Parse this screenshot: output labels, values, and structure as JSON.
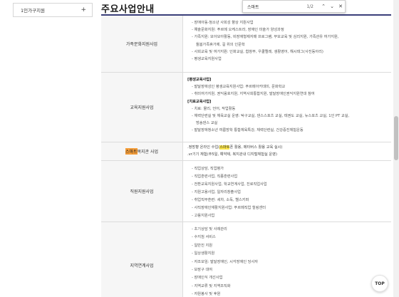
{
  "sidebar": {
    "item_label": "1인가구지원",
    "expand_glyph": "+"
  },
  "page": {
    "title": "주요사업안내"
  },
  "findbar": {
    "query": "스마트",
    "count": "1/2",
    "prev": "⌃",
    "next": "⌄",
    "close": "✕"
  },
  "rows": [
    {
      "name": "가족문화지원사업",
      "lines": [
        {
          "t": "장애아동·청소년 사회성 향상 지원사업",
          "k": "dash"
        },
        {
          "t": "예술문화지원: 푸르메 오케스트라, 장애인 미술가 양성과정",
          "k": "dash"
        },
        {
          "t": "가족지원: 모아모아활동, 비장애형제자매 프로그램, 부모교육 및 심리지원, 가족관유 여가지원,",
          "k": "dash"
        },
        {
          "t": "돌봄가족휴가제, 길 위의 인문학",
          "k": "cont"
        },
        {
          "t": "사회교육 및 여가지원: 인화교실, 합창부, 우쿨렐레, 생활영어, 해시태그(사진동아리)",
          "k": "dash"
        },
        {
          "t": "평생교육지원사업",
          "k": "dash"
        }
      ]
    },
    {
      "name": "교육지원사업",
      "lines": [
        {
          "t": "[평생교육사업]",
          "k": "head"
        },
        {
          "t": "발달장애성인 평생교육지원사업: 푸르메아카데미, 문화학교",
          "k": "dash"
        },
        {
          "t": "취미여가지원, 권익옹호지원, 지역사회통합지원, 발달장애인권익지원연대 참여",
          "k": "dash"
        },
        {
          "t": "[치료교육사업]",
          "k": "head"
        },
        {
          "t": "치료: 물리, 언어, 작업활동",
          "k": "dash"
        },
        {
          "t": "체력단련실 및 체육교실 운영: 탁구교실, 댄스스포츠 교실, 태권도 교실, 뉴스포츠 교실, 1인 PT 교실,",
          "k": "dash"
        },
        {
          "t": "방송댄스 교실",
          "k": "cont"
        },
        {
          "t": "발달장애청소년 여름방학 통합체육특강, 체력단련실, 건강증진체험운동",
          "k": "dash"
        }
      ]
    },
    {
      "name_hl": "스마트",
      "name_rest": "복지관 사업",
      "lines": [
        {
          "t": ".정방향 온라인 수업(",
          "hl": "스마트",
          "t2": "폰 활용, 메타버스 활용 교육 실시)",
          "k": "plain"
        },
        {
          "t": ".vr기기 체험(주5일, 예약제, 복지관내 디지털체험실 운영)",
          "k": "plain"
        }
      ]
    },
    {
      "name": "직원지원사업",
      "lines": [
        {
          "t": "직업상담, 직업평가",
          "k": "dash"
        },
        {
          "t": "직업훈련사업, 직종훈련사업",
          "k": "dash"
        },
        {
          "t": "전환교육지원사업, 학교연계사업, 진로직업사업",
          "k": "dash"
        },
        {
          "t": "지원고용사업, 일자리창출사업",
          "k": "dash"
        },
        {
          "t": "취업직무훈련: 세차, 소독, 헬스키퍼",
          "k": "dash"
        },
        {
          "t": "사직장애인재활지원사업: 푸르메직업 힐링센터",
          "k": "dash"
        },
        {
          "t": "고용지원사업",
          "k": "dash"
        }
      ]
    },
    {
      "name": "지역연계사업",
      "lines": [
        {
          "t": "초기상담 및 사례관리",
          "k": "dash"
        },
        {
          "t": "수지침 서비스",
          "k": "dash"
        },
        {
          "t": "일반진 지원",
          "k": "dash"
        },
        {
          "t": "일상생활지원",
          "k": "dash"
        },
        {
          "t": "자조모임: 발달장애인, 시각장애인 당사자",
          "k": "dash"
        },
        {
          "t": "보장구 대여",
          "k": "dash"
        },
        {
          "t": "장애인식 개선사업",
          "k": "dash"
        },
        {
          "t": "지역교류 및 지역조직화",
          "k": "dash"
        },
        {
          "t": "자원봉사 및 후원",
          "k": "dash"
        }
      ]
    }
  ],
  "top_button": "TOP"
}
